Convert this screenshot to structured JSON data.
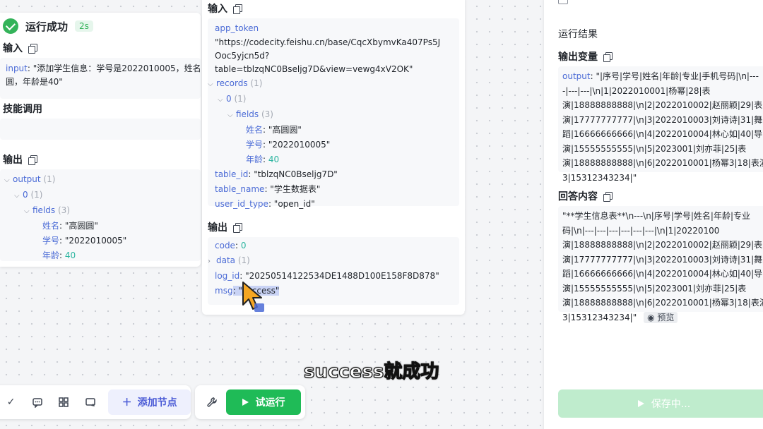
{
  "left": {
    "status": "运行成功",
    "duration": "2s",
    "input_title": "输入",
    "input_key": "input",
    "input_value_line1": ": \"添加学生信息：学号是2022010005，姓名",
    "input_value_line2": "圆，年龄是40\"",
    "skill_title": "技能调用",
    "output_title": "输出",
    "output": {
      "root_key": "output",
      "root_count": "(1)",
      "item_key": "0",
      "item_count": "(1)",
      "fields_key": "fields",
      "fields_count": "(3)",
      "name_key": "姓名",
      "name_value": ": \"高圆圆\"",
      "id_key": "学号",
      "id_value": ": \"2022010005\"",
      "age_key": "年龄",
      "age_value": "40"
    }
  },
  "middle": {
    "input_title": "输入",
    "app_token_key": "app_token",
    "app_token_line1": "\"https://codecity.feishu.cn/base/CqcXbymvKa407Ps5J",
    "app_token_line2": "Ooc5yjcn5d?",
    "app_token_line3": "table=tblzqNC0Bseljg7D&view=vewg4xV2OK\"",
    "records_key": "records",
    "records_count": "(1)",
    "item_key": "0",
    "item_count": "(1)",
    "fields_key": "fields",
    "fields_count": "(3)",
    "name_key": "姓名",
    "name_value": ": \"高圆圆\"",
    "id_key": "学号",
    "id_value": ": \"2022010005\"",
    "age_key": "年龄",
    "age_value": "40",
    "table_id_key": "table_id",
    "table_id_value": ": \"tblzqNC0Bseljg7D\"",
    "table_name_key": "table_name",
    "table_name_value": ": \"学生数据表\"",
    "user_id_type_key": "user_id_type",
    "user_id_type_value": ": \"open_id\"",
    "output_title": "输出",
    "code_key": "code",
    "code_value": "0",
    "data_key": "data",
    "data_count": "(1)",
    "log_id_key": "log_id",
    "log_id_value": ": \"20250514122534DE1488D100E158F8D878\"",
    "msg_key": "msg",
    "msg_value": ": \"success\""
  },
  "right": {
    "run_result_title": "运行结果",
    "output_var_title": "输出变量",
    "output_key": "output",
    "output_lines": [
      ": \"|序号|学号|姓名|年龄|专业|手机号码|\\n|---",
      "-|---|---|\\n|1|2022010001|杨幂|28|表",
      "演|18888888888|\\n|2|2022010002|赵丽颖|29|表",
      "演|17777777777|\\n|3|2022010003|刘诗诗|31|舞",
      "蹈|16666666666|\\n|4|2022010004|林心如|40|导",
      "演|15555555555|\\n|5|2023001|刘亦菲|25|表",
      "演|18888888888|\\n|6|2022010001|杨幂3|18|表演",
      "3|15312343234|\""
    ],
    "answer_title": "回答内容",
    "answer_lines": [
      "\"**学生信息表**\\n---\\n|序号|学号|姓名|年龄|专业",
      "码|\\n|---|---|---|---|---|---|\\n|1|20220100",
      "演|18888888888|\\n|2|2022010002|赵丽颖|29|表",
      "演|17777777777|\\n|3|2022010003|刘诗诗|31|舞",
      "蹈|16666666666|\\n|4|2022010004|林心如|40|导",
      "演|15555555555|\\n|5|2023001|刘亦菲|25|表",
      "演|18888888888|\\n|6|2022010001|杨幂3|18|表演",
      "3|15312343234|\""
    ],
    "preview_label": "预览",
    "save_label": "保存中..."
  },
  "toolbar": {
    "add_node_label": "添加节点",
    "test_run_label": "试运行"
  },
  "subtitle": "success就成功"
}
